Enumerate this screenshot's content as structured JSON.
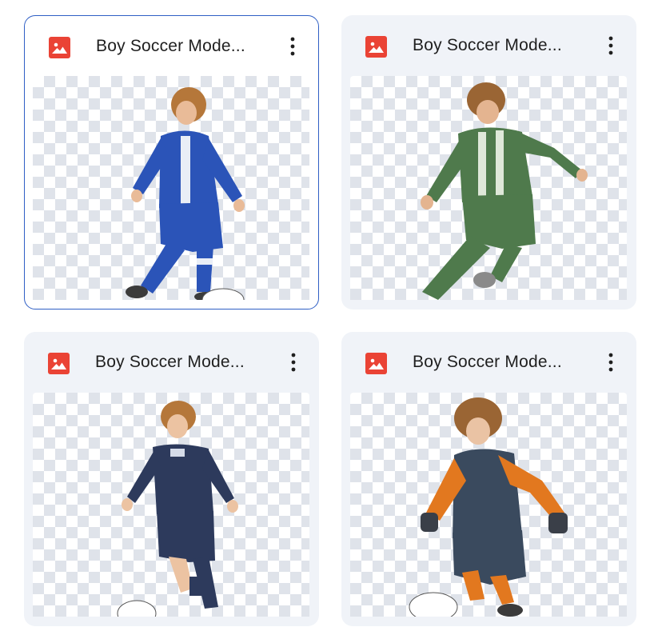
{
  "files": [
    {
      "name": "Boy Soccer Mode...",
      "selected": true,
      "icon": "image-file-icon",
      "kit_primary": "#2b54b8",
      "kit_secondary": "#e9eef6"
    },
    {
      "name": "Boy Soccer Mode...",
      "selected": false,
      "icon": "image-file-icon",
      "kit_primary": "#4f7a4c",
      "kit_secondary": "#dfe8d9"
    },
    {
      "name": "Boy Soccer Mode...",
      "selected": false,
      "icon": "image-file-icon",
      "kit_primary": "#2d3a5c",
      "kit_secondary": "#d5dbe8"
    },
    {
      "name": "Boy Soccer Mode...",
      "selected": false,
      "icon": "image-file-icon",
      "kit_primary": "#3a4a5e",
      "kit_secondary": "#e2781f"
    }
  ],
  "colors": {
    "icon_red": "#ea4335",
    "card_bg": "#f0f3f8",
    "selected_border": "#2f5fc5"
  }
}
